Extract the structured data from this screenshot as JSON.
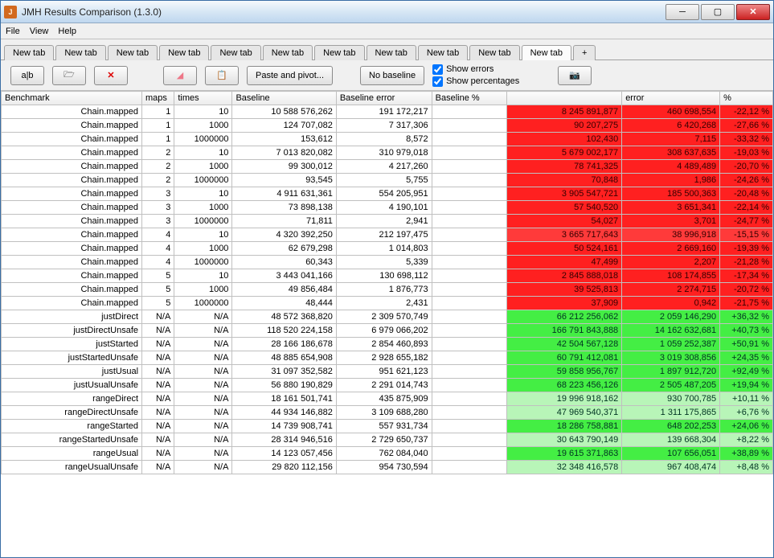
{
  "window": {
    "title": "JMH Results Comparison (1.3.0)",
    "app_icon_letter": "J"
  },
  "menu": {
    "items": [
      "File",
      "View",
      "Help"
    ]
  },
  "tabs": {
    "items": [
      "New tab",
      "New tab",
      "New tab",
      "New tab",
      "New tab",
      "New tab",
      "New tab",
      "New tab",
      "New tab",
      "New tab",
      "New tab"
    ],
    "active_index": 10,
    "add": "+"
  },
  "toolbar": {
    "compare_icon": "a|b",
    "paste_pivot": "Paste and pivot...",
    "no_baseline": "No baseline",
    "show_errors": "Show errors",
    "show_percentages": "Show percentages"
  },
  "table": {
    "headers": [
      "Benchmark",
      "maps",
      "times",
      "Baseline",
      "Baseline error",
      "Baseline %",
      "",
      "error",
      "%"
    ],
    "rows": [
      {
        "name": "Chain.mapped",
        "maps": "1",
        "times": "10",
        "baseline": "10 588 576,262",
        "berr": "191 172,217",
        "bpct": "",
        "val": "8 245 891,877",
        "err": "460 698,554",
        "pct": "-22,12 %",
        "shade": "red1"
      },
      {
        "name": "Chain.mapped",
        "maps": "1",
        "times": "1000",
        "baseline": "124 707,082",
        "berr": "7 317,306",
        "bpct": "",
        "val": "90 207,275",
        "err": "6 420,268",
        "pct": "-27,66 %",
        "shade": "red1"
      },
      {
        "name": "Chain.mapped",
        "maps": "1",
        "times": "1000000",
        "baseline": "153,612",
        "berr": "8,572",
        "bpct": "",
        "val": "102,430",
        "err": "7,115",
        "pct": "-33,32 %",
        "shade": "red1"
      },
      {
        "name": "Chain.mapped",
        "maps": "2",
        "times": "10",
        "baseline": "7 013 820,082",
        "berr": "310 979,018",
        "bpct": "",
        "val": "5 679 002,177",
        "err": "308 637,635",
        "pct": "-19,03 %",
        "shade": "red1"
      },
      {
        "name": "Chain.mapped",
        "maps": "2",
        "times": "1000",
        "baseline": "99 300,012",
        "berr": "4 217,260",
        "bpct": "",
        "val": "78 741,325",
        "err": "4 489,489",
        "pct": "-20,70 %",
        "shade": "red1"
      },
      {
        "name": "Chain.mapped",
        "maps": "2",
        "times": "1000000",
        "baseline": "93,545",
        "berr": "5,755",
        "bpct": "",
        "val": "70,848",
        "err": "1,986",
        "pct": "-24,26 %",
        "shade": "red1"
      },
      {
        "name": "Chain.mapped",
        "maps": "3",
        "times": "10",
        "baseline": "4 911 631,361",
        "berr": "554 205,951",
        "bpct": "",
        "val": "3 905 547,721",
        "err": "185 500,363",
        "pct": "-20,48 %",
        "shade": "red1"
      },
      {
        "name": "Chain.mapped",
        "maps": "3",
        "times": "1000",
        "baseline": "73 898,138",
        "berr": "4 190,101",
        "bpct": "",
        "val": "57 540,520",
        "err": "3 651,341",
        "pct": "-22,14 %",
        "shade": "red1"
      },
      {
        "name": "Chain.mapped",
        "maps": "3",
        "times": "1000000",
        "baseline": "71,811",
        "berr": "2,941",
        "bpct": "",
        "val": "54,027",
        "err": "3,701",
        "pct": "-24,77 %",
        "shade": "red1"
      },
      {
        "name": "Chain.mapped",
        "maps": "4",
        "times": "10",
        "baseline": "4 320 392,250",
        "berr": "212 197,475",
        "bpct": "",
        "val": "3 665 717,643",
        "err": "38 996,918",
        "pct": "-15,15 %",
        "shade": "red2"
      },
      {
        "name": "Chain.mapped",
        "maps": "4",
        "times": "1000",
        "baseline": "62 679,298",
        "berr": "1 014,803",
        "bpct": "",
        "val": "50 524,161",
        "err": "2 669,160",
        "pct": "-19,39 %",
        "shade": "red1"
      },
      {
        "name": "Chain.mapped",
        "maps": "4",
        "times": "1000000",
        "baseline": "60,343",
        "berr": "5,339",
        "bpct": "",
        "val": "47,499",
        "err": "2,207",
        "pct": "-21,28 %",
        "shade": "red1"
      },
      {
        "name": "Chain.mapped",
        "maps": "5",
        "times": "10",
        "baseline": "3 443 041,166",
        "berr": "130 698,112",
        "bpct": "",
        "val": "2 845 888,018",
        "err": "108 174,855",
        "pct": "-17,34 %",
        "shade": "red1"
      },
      {
        "name": "Chain.mapped",
        "maps": "5",
        "times": "1000",
        "baseline": "49 856,484",
        "berr": "1 876,773",
        "bpct": "",
        "val": "39 525,813",
        "err": "2 274,715",
        "pct": "-20,72 %",
        "shade": "red1"
      },
      {
        "name": "Chain.mapped",
        "maps": "5",
        "times": "1000000",
        "baseline": "48,444",
        "berr": "2,431",
        "bpct": "",
        "val": "37,909",
        "err": "0,942",
        "pct": "-21,75 %",
        "shade": "red1"
      },
      {
        "name": "justDirect",
        "maps": "N/A",
        "times": "N/A",
        "baseline": "48 572 368,820",
        "berr": "2 309 570,749",
        "bpct": "",
        "val": "66 212 256,062",
        "err": "2 059 146,290",
        "pct": "+36,32 %",
        "shade": "green1"
      },
      {
        "name": "justDirectUnsafe",
        "maps": "N/A",
        "times": "N/A",
        "baseline": "118 520 224,158",
        "berr": "6 979 066,202",
        "bpct": "",
        "val": "166 791 843,888",
        "err": "14 162 632,681",
        "pct": "+40,73 %",
        "shade": "green1"
      },
      {
        "name": "justStarted",
        "maps": "N/A",
        "times": "N/A",
        "baseline": "28 166 186,678",
        "berr": "2 854 460,893",
        "bpct": "",
        "val": "42 504 567,128",
        "err": "1 059 252,387",
        "pct": "+50,91 %",
        "shade": "green1"
      },
      {
        "name": "justStartedUnsafe",
        "maps": "N/A",
        "times": "N/A",
        "baseline": "48 885 654,908",
        "berr": "2 928 655,182",
        "bpct": "",
        "val": "60 791 412,081",
        "err": "3 019 308,856",
        "pct": "+24,35 %",
        "shade": "green1"
      },
      {
        "name": "justUsual",
        "maps": "N/A",
        "times": "N/A",
        "baseline": "31 097 352,582",
        "berr": "951 621,123",
        "bpct": "",
        "val": "59 858 956,767",
        "err": "1 897 912,720",
        "pct": "+92,49 %",
        "shade": "green1"
      },
      {
        "name": "justUsualUnsafe",
        "maps": "N/A",
        "times": "N/A",
        "baseline": "56 880 190,829",
        "berr": "2 291 014,743",
        "bpct": "",
        "val": "68 223 456,126",
        "err": "2 505 487,205",
        "pct": "+19,94 %",
        "shade": "green1"
      },
      {
        "name": "rangeDirect",
        "maps": "N/A",
        "times": "N/A",
        "baseline": "18 161 501,741",
        "berr": "435 875,909",
        "bpct": "",
        "val": "19 996 918,162",
        "err": "930 700,785",
        "pct": "+10,11 %",
        "shade": "green2"
      },
      {
        "name": "rangeDirectUnsafe",
        "maps": "N/A",
        "times": "N/A",
        "baseline": "44 934 146,882",
        "berr": "3 109 688,280",
        "bpct": "",
        "val": "47 969 540,371",
        "err": "1 311 175,865",
        "pct": "+6,76 %",
        "shade": "green2"
      },
      {
        "name": "rangeStarted",
        "maps": "N/A",
        "times": "N/A",
        "baseline": "14 739 908,741",
        "berr": "557 931,734",
        "bpct": "",
        "val": "18 286 758,881",
        "err": "648 202,253",
        "pct": "+24,06 %",
        "shade": "green1"
      },
      {
        "name": "rangeStartedUnsafe",
        "maps": "N/A",
        "times": "N/A",
        "baseline": "28 314 946,516",
        "berr": "2 729 650,737",
        "bpct": "",
        "val": "30 643 790,149",
        "err": "139 668,304",
        "pct": "+8,22 %",
        "shade": "green2"
      },
      {
        "name": "rangeUsual",
        "maps": "N/A",
        "times": "N/A",
        "baseline": "14 123 057,456",
        "berr": "762 084,040",
        "bpct": "",
        "val": "19 615 371,863",
        "err": "107 656,051",
        "pct": "+38,89 %",
        "shade": "green1"
      },
      {
        "name": "rangeUsualUnsafe",
        "maps": "N/A",
        "times": "N/A",
        "baseline": "29 820 112,156",
        "berr": "954 730,594",
        "bpct": "",
        "val": "32 348 416,578",
        "err": "967 408,474",
        "pct": "+8,48 %",
        "shade": "green2"
      }
    ]
  }
}
